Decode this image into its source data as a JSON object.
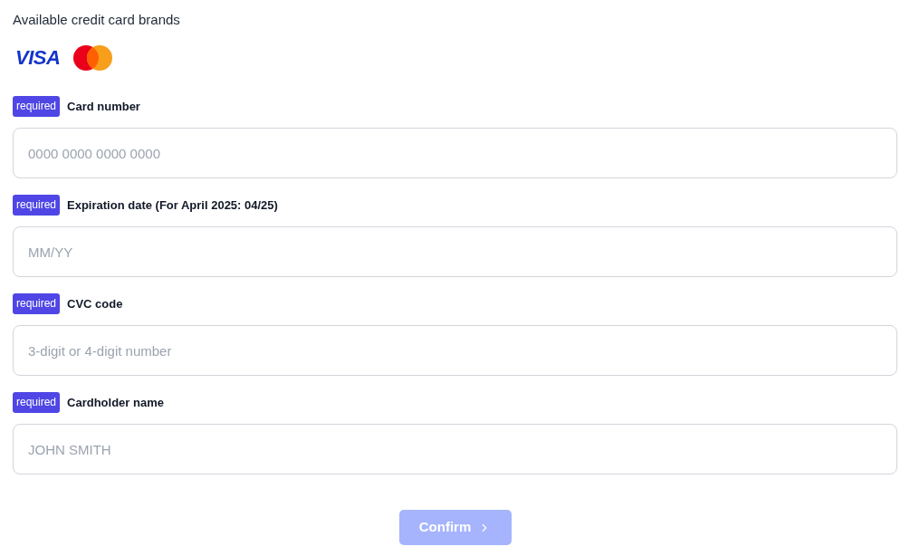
{
  "title": "Available credit card brands",
  "brands": [
    {
      "kind": "visa",
      "label": "VISA"
    },
    {
      "kind": "mastercard"
    }
  ],
  "fields": [
    {
      "badge": "required",
      "label": "Card number",
      "placeholder": "0000 0000 0000 0000"
    },
    {
      "badge": "required",
      "label": "Expiration date (For April 2025: 04/25)",
      "placeholder": "MM/YY"
    },
    {
      "badge": "required",
      "label": "CVC code",
      "placeholder": "3-digit or 4-digit number"
    },
    {
      "badge": "required",
      "label": "Cardholder name",
      "placeholder": "JOHN SMITH"
    }
  ],
  "confirm_button": {
    "label": "Confirm",
    "disabled": true
  }
}
